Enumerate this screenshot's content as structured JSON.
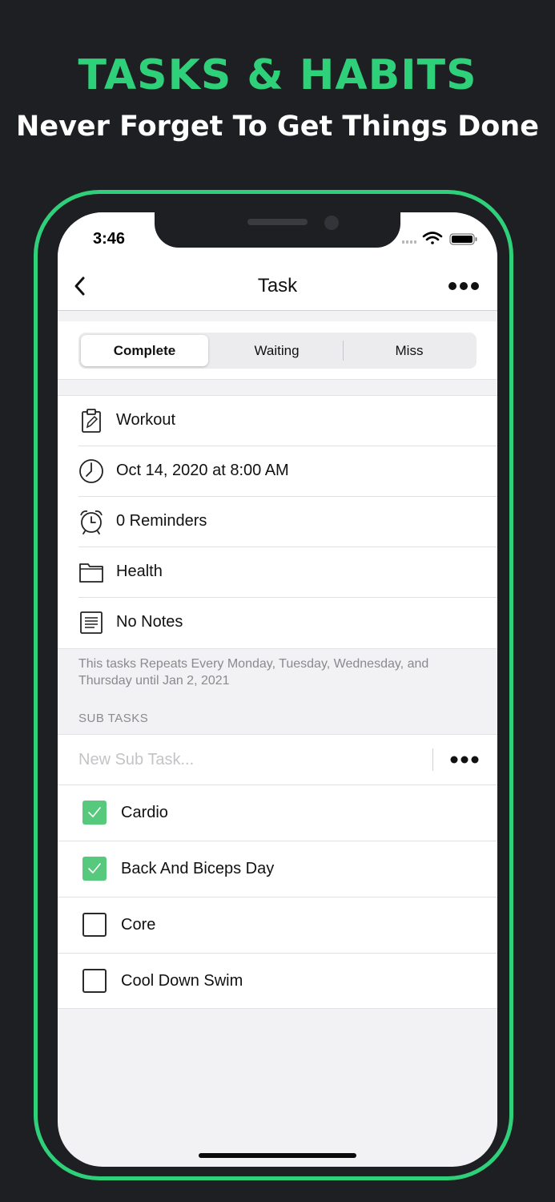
{
  "promo": {
    "headline": "TASKS & HABITS",
    "subheadline": "Never Forget To Get Things Done"
  },
  "colors": {
    "accent": "#2fd07a",
    "background": "#1e1f22",
    "checkbox_checked": "#56c97d"
  },
  "status_bar": {
    "time": "3:46",
    "icons": [
      "signal-icon",
      "wifi-icon",
      "battery-icon"
    ]
  },
  "nav": {
    "back_icon": "chevron-left-icon",
    "title": "Task",
    "more_icon": "ellipsis-icon"
  },
  "status_segments": {
    "options": [
      "Complete",
      "Waiting",
      "Miss"
    ],
    "selected": "Complete"
  },
  "details": [
    {
      "icon": "clipboard-icon",
      "label": "Workout"
    },
    {
      "icon": "clock-icon",
      "label": "Oct 14, 2020 at 8:00 AM"
    },
    {
      "icon": "alarm-clock-icon",
      "label": "0 Reminders"
    },
    {
      "icon": "folder-icon",
      "label": "Health"
    },
    {
      "icon": "notes-icon",
      "label": "No Notes"
    }
  ],
  "repeat_note": "This tasks Repeats Every Monday, Tuesday, Wednesday, and Thursday until Jan 2, 2021",
  "subtasks": {
    "section_title": "SUB TASKS",
    "new_placeholder": "New Sub Task...",
    "new_value": "",
    "items": [
      {
        "label": "Cardio",
        "checked": true
      },
      {
        "label": "Back And Biceps Day",
        "checked": true
      },
      {
        "label": "Core",
        "checked": false
      },
      {
        "label": "Cool Down Swim",
        "checked": false
      }
    ]
  }
}
